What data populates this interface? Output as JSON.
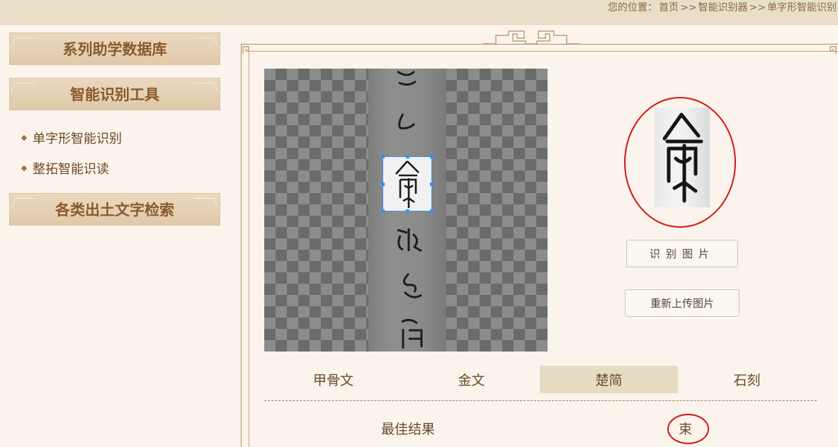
{
  "breadcrumb": {
    "prefix": "您的位置：",
    "home": "首页",
    "sep1": ">>",
    "level2": "智能识别器",
    "sep2": ">>",
    "level3": "单字形智能识别"
  },
  "sidebar": {
    "sections": [
      {
        "title": "系列助学数据库"
      },
      {
        "title": "智能识别工具"
      },
      {
        "title": "各类出土文字检索"
      }
    ],
    "items": [
      {
        "label": "单字形智能识别"
      },
      {
        "label": "整拓智能识读"
      }
    ]
  },
  "buttons": {
    "recognize": "识别图片",
    "reupload": "重新上传图片"
  },
  "tabs": [
    {
      "label": "甲骨文",
      "active": false
    },
    {
      "label": "金文",
      "active": false
    },
    {
      "label": "楚简",
      "active": true
    },
    {
      "label": "石刻",
      "active": false
    }
  ],
  "result": {
    "label": "最佳结果",
    "value": "束"
  },
  "colors": {
    "accent_red": "#d31414",
    "selection_blue": "#3d8ef0",
    "active_tab": "#e6dcc4"
  }
}
